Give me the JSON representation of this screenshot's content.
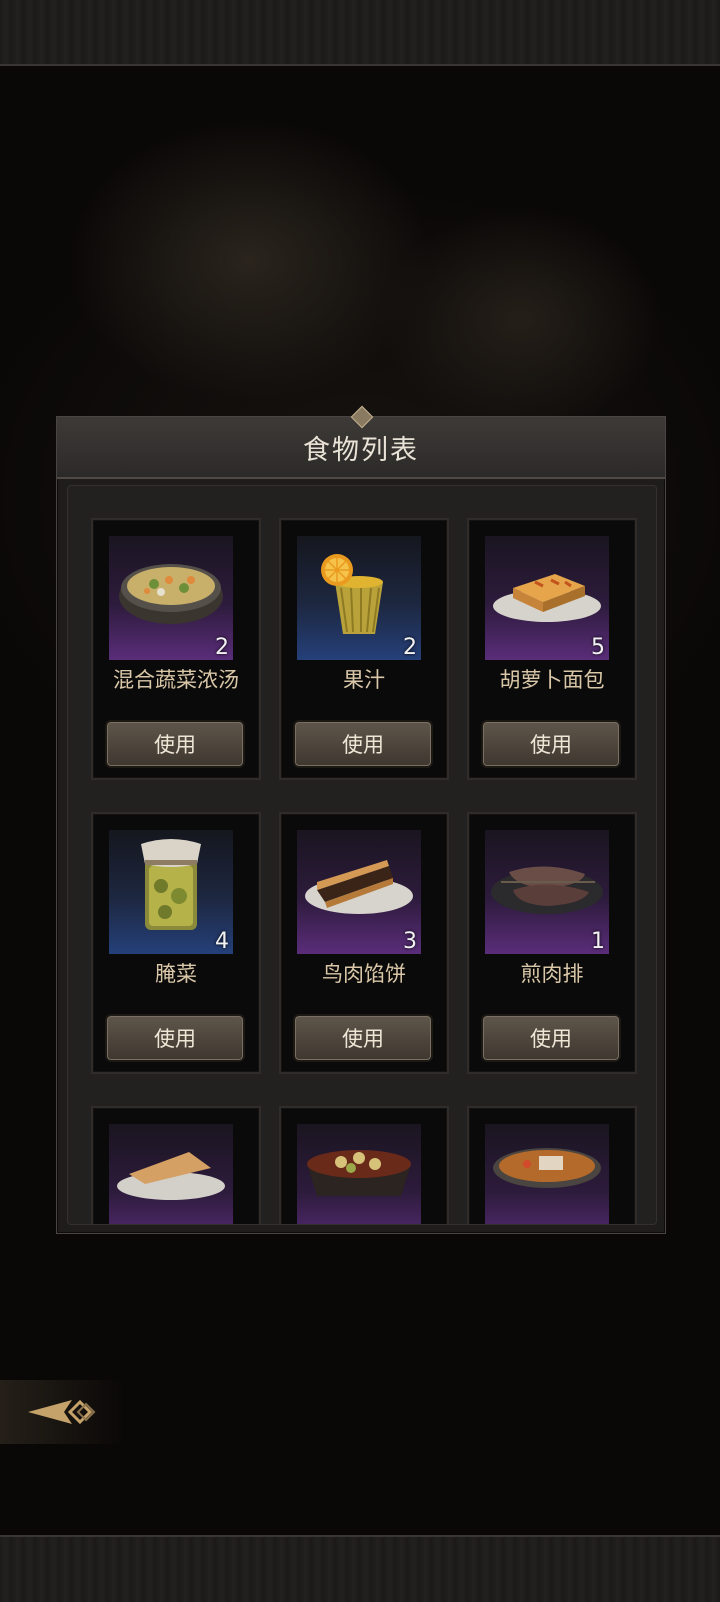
{
  "panel": {
    "title": "食物列表"
  },
  "use_label": "使用",
  "items": [
    {
      "name": "混合蔬菜浓汤",
      "qty": "2",
      "rarity": "purple",
      "icon": "vegetable-soup-icon"
    },
    {
      "name": "果汁",
      "qty": "2",
      "rarity": "blue",
      "icon": "juice-icon"
    },
    {
      "name": "胡萝卜面包",
      "qty": "5",
      "rarity": "purple",
      "icon": "carrot-bread-icon"
    },
    {
      "name": "腌菜",
      "qty": "4",
      "rarity": "blue",
      "icon": "pickle-jar-icon"
    },
    {
      "name": "鸟肉馅饼",
      "qty": "3",
      "rarity": "purple",
      "icon": "bird-meat-pie-icon"
    },
    {
      "name": "煎肉排",
      "qty": "1",
      "rarity": "purple",
      "icon": "fried-steak-icon"
    }
  ],
  "partial_items": [
    {
      "rarity": "purple",
      "icon": "pie-slice-icon"
    },
    {
      "rarity": "purple",
      "icon": "stew-icon"
    },
    {
      "rarity": "purple",
      "icon": "curry-bowl-icon"
    }
  ],
  "colors": {
    "rarity_purple": "#5a2d7a",
    "rarity_blue": "#25407a",
    "title_text": "#e9e2d6",
    "name_text": "#d9c7a8"
  }
}
